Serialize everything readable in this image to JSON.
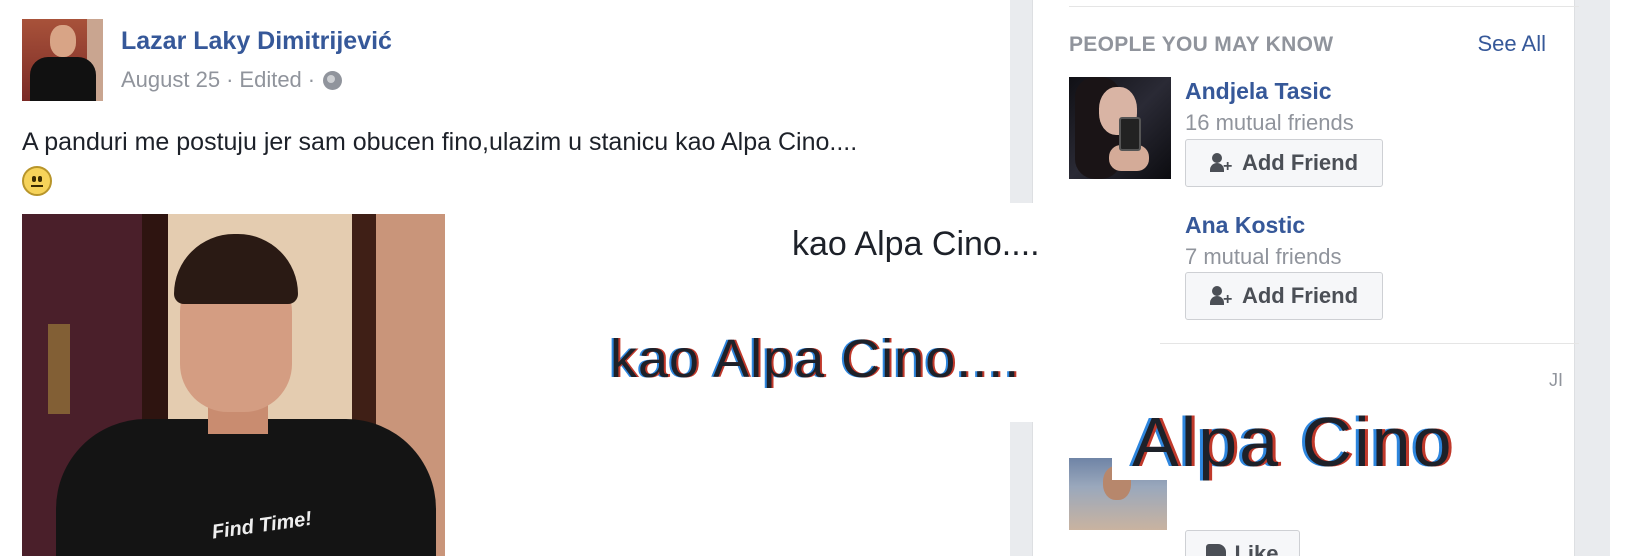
{
  "post": {
    "author": "Lazar Laky Dimitrijević",
    "date": "August 25",
    "separator": "·",
    "edited": "Edited",
    "privacy_icon": "globe-icon",
    "text": "A panduri me postuju jer sam obucen fino,ulazim u stanicu kao Alpa Cino....",
    "emoji": "smile-emoji",
    "shirt_print": "Find Time!"
  },
  "sidebar": {
    "pymk_title": "PEOPLE YOU MAY KNOW",
    "see_all": "See All",
    "people": [
      {
        "name": "Andjela Tasic",
        "mutual": "16 mutual friends",
        "button": "Add Friend"
      },
      {
        "name": "Ana Kostic",
        "mutual": "7 mutual friends",
        "button": "Add Friend"
      }
    ],
    "corner_text": "JI",
    "like_button": "Like"
  },
  "overlays": {
    "caption_small": "kao Alpa Cino....",
    "caption_medium": "kao Alpa Cino....",
    "caption_large": "Alpa Cino"
  },
  "colors": {
    "link": "#365899",
    "meta": "#90949c",
    "rail_bg": "#e9ebee"
  }
}
